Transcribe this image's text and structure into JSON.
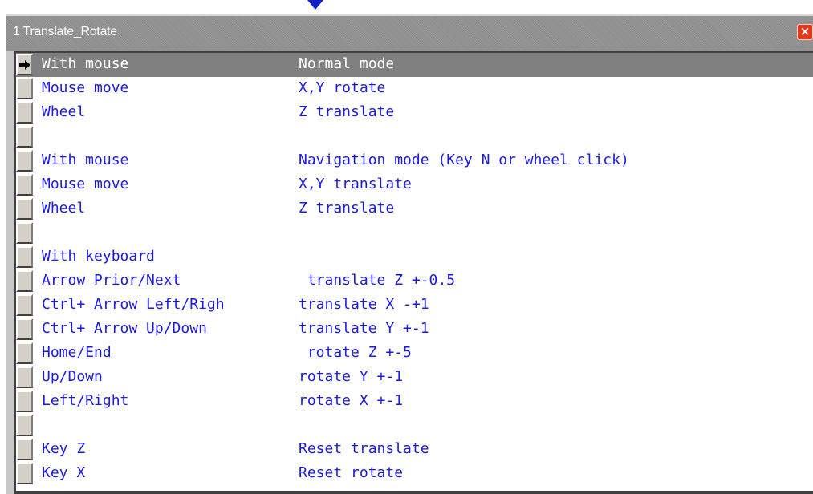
{
  "window": {
    "title": "1 Translate_Rotate",
    "close_glyph": "×",
    "accent_colors": {
      "text": "#1a1ae0",
      "selected_row": "#808080",
      "close_button": "#e03818"
    }
  },
  "grid": {
    "selected_row": 0,
    "indicator_icon": "arrow-right-icon",
    "rows": [
      {
        "a": "With mouse",
        "b": "Normal mode"
      },
      {
        "a": "Mouse move",
        "b": "X,Y rotate"
      },
      {
        "a": "Wheel",
        "b": "Z translate"
      },
      {
        "a": "",
        "b": ""
      },
      {
        "a": "With mouse",
        "b": "Navigation mode (Key N or wheel click)"
      },
      {
        "a": "Mouse move",
        "b": "X,Y translate"
      },
      {
        "a": "Wheel",
        "b": "Z translate"
      },
      {
        "a": "",
        "b": ""
      },
      {
        "a": "With keyboard",
        "b": ""
      },
      {
        "a": "Arrow Prior/Next",
        "b": " translate Z +-0.5"
      },
      {
        "a": "Ctrl+ Arrow Left/Righ",
        "b": "translate X -+1"
      },
      {
        "a": "Ctrl+ Arrow Up/Down",
        "b": "translate Y +-1"
      },
      {
        "a": "Home/End",
        "b": " rotate Z +-5"
      },
      {
        "a": "Up/Down",
        "b": "rotate Y +-1"
      },
      {
        "a": "Left/Right",
        "b": "rotate X +-1"
      },
      {
        "a": "",
        "b": ""
      },
      {
        "a": "Key Z",
        "b": "Reset translate"
      },
      {
        "a": "Key X",
        "b": "Reset rotate"
      }
    ]
  }
}
